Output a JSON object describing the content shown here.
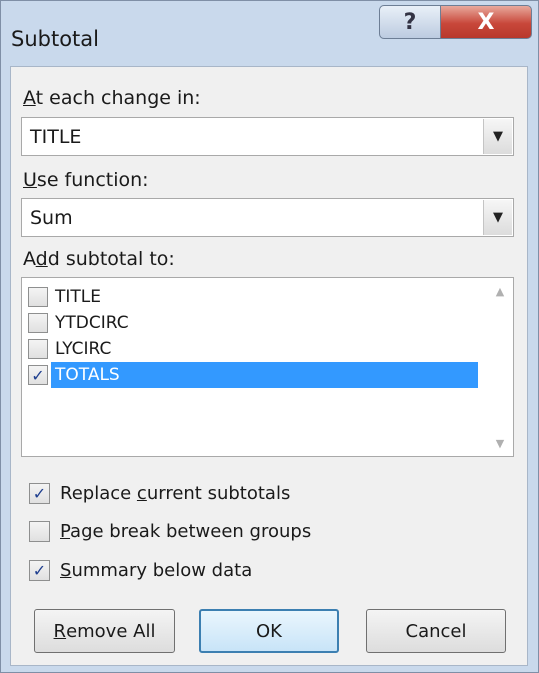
{
  "window": {
    "title": "Subtotal",
    "help_glyph": "?",
    "close_glyph": "X"
  },
  "at_each_change": {
    "label_accel": "A",
    "label_rest": "t each change in:",
    "value": "TITLE"
  },
  "use_function": {
    "label_accel": "U",
    "label_rest": "se function:",
    "value": "Sum"
  },
  "add_subtotal": {
    "label_pre": "A",
    "label_accel": "d",
    "label_rest": "d subtotal to:",
    "items": [
      {
        "label": "TITLE",
        "checked": false
      },
      {
        "label": "YTDCIRC",
        "checked": false
      },
      {
        "label": "LYCIRC",
        "checked": false
      },
      {
        "label": "TOTALS",
        "checked": true
      }
    ]
  },
  "options": {
    "replace": {
      "pre": "Replace ",
      "accel": "c",
      "rest": "urrent subtotals",
      "checked": true
    },
    "page_break": {
      "pre": "",
      "accel": "P",
      "rest": "age break between groups",
      "checked": false
    },
    "summary": {
      "pre": "",
      "accel": "S",
      "rest": "ummary below data",
      "checked": true
    }
  },
  "buttons": {
    "remove_accel": "R",
    "remove_rest": "emove All",
    "ok": "OK",
    "cancel": "Cancel"
  },
  "glyphs": {
    "check": "✓",
    "dropdown": "▼",
    "scroll_up": "▲",
    "scroll_down": "▼"
  },
  "colors": {
    "selection": "#3399ff",
    "close_button": "#c8473a",
    "frame": "#c9d9ec"
  }
}
